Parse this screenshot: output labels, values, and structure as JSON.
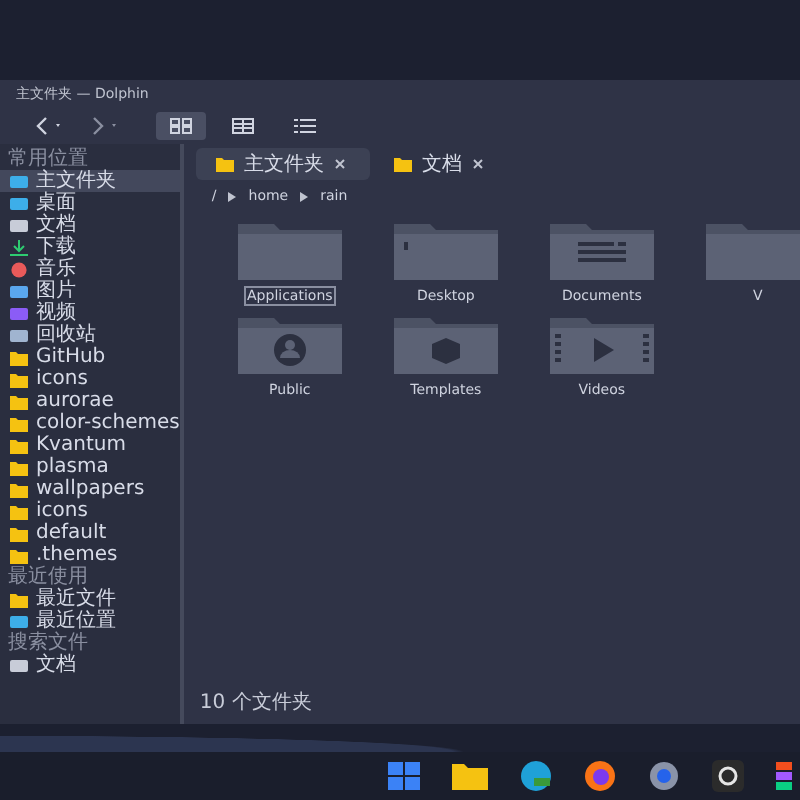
{
  "window": {
    "title": "主文件夹 — Dolphin"
  },
  "toolbar": {
    "views": [
      {
        "kind": "icons",
        "selected": true
      },
      {
        "kind": "compact",
        "selected": false
      },
      {
        "kind": "details",
        "selected": false
      }
    ]
  },
  "sidebar": {
    "sections": [
      {
        "title": "常用位置",
        "items": [
          {
            "label": "主文件夹",
            "kind": "home",
            "selected": true
          },
          {
            "label": "桌面",
            "kind": "desktop",
            "selected": false
          },
          {
            "label": "文档",
            "kind": "document",
            "selected": false
          },
          {
            "label": "下载",
            "kind": "download",
            "selected": false
          },
          {
            "label": "音乐",
            "kind": "music",
            "selected": false
          },
          {
            "label": "图片",
            "kind": "picture",
            "selected": false
          },
          {
            "label": "视频",
            "kind": "video",
            "selected": false
          },
          {
            "label": "回收站",
            "kind": "trash",
            "selected": false
          },
          {
            "label": "GitHub",
            "kind": "folder",
            "selected": false
          },
          {
            "label": "icons",
            "kind": "folder",
            "selected": false
          },
          {
            "label": "aurorae",
            "kind": "folder",
            "selected": false
          },
          {
            "label": "color-schemes",
            "kind": "folder",
            "selected": false
          },
          {
            "label": "Kvantum",
            "kind": "folder",
            "selected": false
          },
          {
            "label": "plasma",
            "kind": "folder",
            "selected": false
          },
          {
            "label": "wallpapers",
            "kind": "folder",
            "selected": false
          },
          {
            "label": "icons",
            "kind": "folder",
            "selected": false
          },
          {
            "label": "default",
            "kind": "folder",
            "selected": false
          },
          {
            "label": ".themes",
            "kind": "folder",
            "selected": false
          }
        ]
      },
      {
        "title": "最近使用",
        "items": [
          {
            "label": "最近文件",
            "kind": "recent-files",
            "selected": false
          },
          {
            "label": "最近位置",
            "kind": "recent-places",
            "selected": false
          }
        ]
      },
      {
        "title": "搜索文件",
        "items": [
          {
            "label": "文档",
            "kind": "document",
            "selected": false
          }
        ]
      }
    ]
  },
  "tabs": [
    {
      "label": "主文件夹",
      "selected": true
    },
    {
      "label": "文档",
      "selected": false
    }
  ],
  "breadcrumb": [
    "/",
    "home",
    "rain"
  ],
  "folders": [
    {
      "name": "Applications",
      "kind": "plain",
      "selected": true
    },
    {
      "name": "Desktop",
      "kind": "desktop",
      "selected": false
    },
    {
      "name": "Documents",
      "kind": "documents",
      "selected": false
    },
    {
      "name": "V",
      "kind": "plain",
      "selected": false
    },
    {
      "name": "Public",
      "kind": "public",
      "selected": false
    },
    {
      "name": "Templates",
      "kind": "templates",
      "selected": false
    },
    {
      "name": "Videos",
      "kind": "videos",
      "selected": false
    }
  ],
  "status_bar": {
    "text": "10 个文件夹"
  }
}
